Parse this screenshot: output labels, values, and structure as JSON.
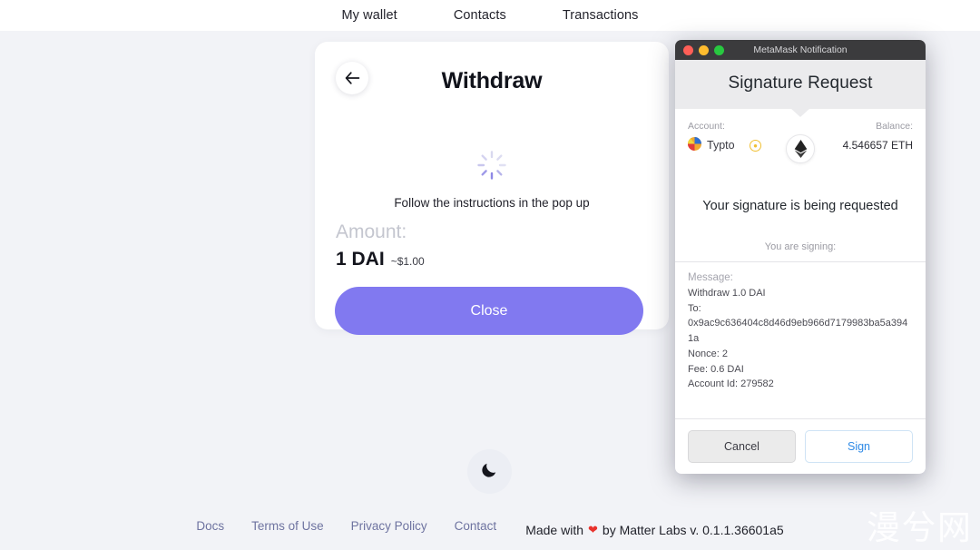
{
  "nav": {
    "items": [
      {
        "label": "My wallet"
      },
      {
        "label": "Contacts"
      },
      {
        "label": "Transactions"
      }
    ]
  },
  "withdraw_card": {
    "title": "Withdraw",
    "back_icon": "arrow-left-icon",
    "loader_icon": "spinner-icon",
    "instructions": "Follow the instructions in the pop up",
    "amount_label": "Amount:",
    "amount_value": "1 DAI",
    "amount_usd": "~$1.00",
    "close_label": "Close"
  },
  "theme_toggle": {
    "icon": "moon-icon"
  },
  "footer": {
    "links": [
      {
        "label": "Docs"
      },
      {
        "label": "Terms of Use"
      },
      {
        "label": "Privacy Policy"
      },
      {
        "label": "Contact"
      }
    ],
    "made_with_prefix": "Made with",
    "heart": "❤",
    "made_with_suffix": "by Matter Labs v. 0.1.1.36601a5"
  },
  "watermark": {
    "text": "漫兮网"
  },
  "metamask": {
    "window_title": "MetaMask Notification",
    "traffic_lights": [
      "close-red",
      "minimize-yellow",
      "zoom-green"
    ],
    "header_title": "Signature Request",
    "account_label": "Account:",
    "account_name": "Typto",
    "account_avatar": "jazzicon-avatar",
    "network_icon": "ethereum-diamond-icon",
    "coin_icon": "token-coin-icon",
    "balance_label": "Balance:",
    "balance_value": "4.546657 ETH",
    "headline": "Your signature is being requested",
    "signing_label": "You are signing:",
    "message_label": "Message:",
    "message_lines": [
      "Withdraw 1.0 DAI",
      "To:",
      "0x9ac9c636404c8d46d9eb966d7179983ba5a3941a",
      "Nonce: 2",
      "Fee: 0.6 DAI",
      "Account Id: 279582"
    ],
    "cancel_label": "Cancel",
    "sign_label": "Sign"
  },
  "colors": {
    "page_bg": "#f2f3f7",
    "accent_purple": "#8179f0",
    "footer_link": "#6e73a0",
    "sign_blue": "#2e8ae6",
    "titlebar": "#3b3b3d"
  }
}
